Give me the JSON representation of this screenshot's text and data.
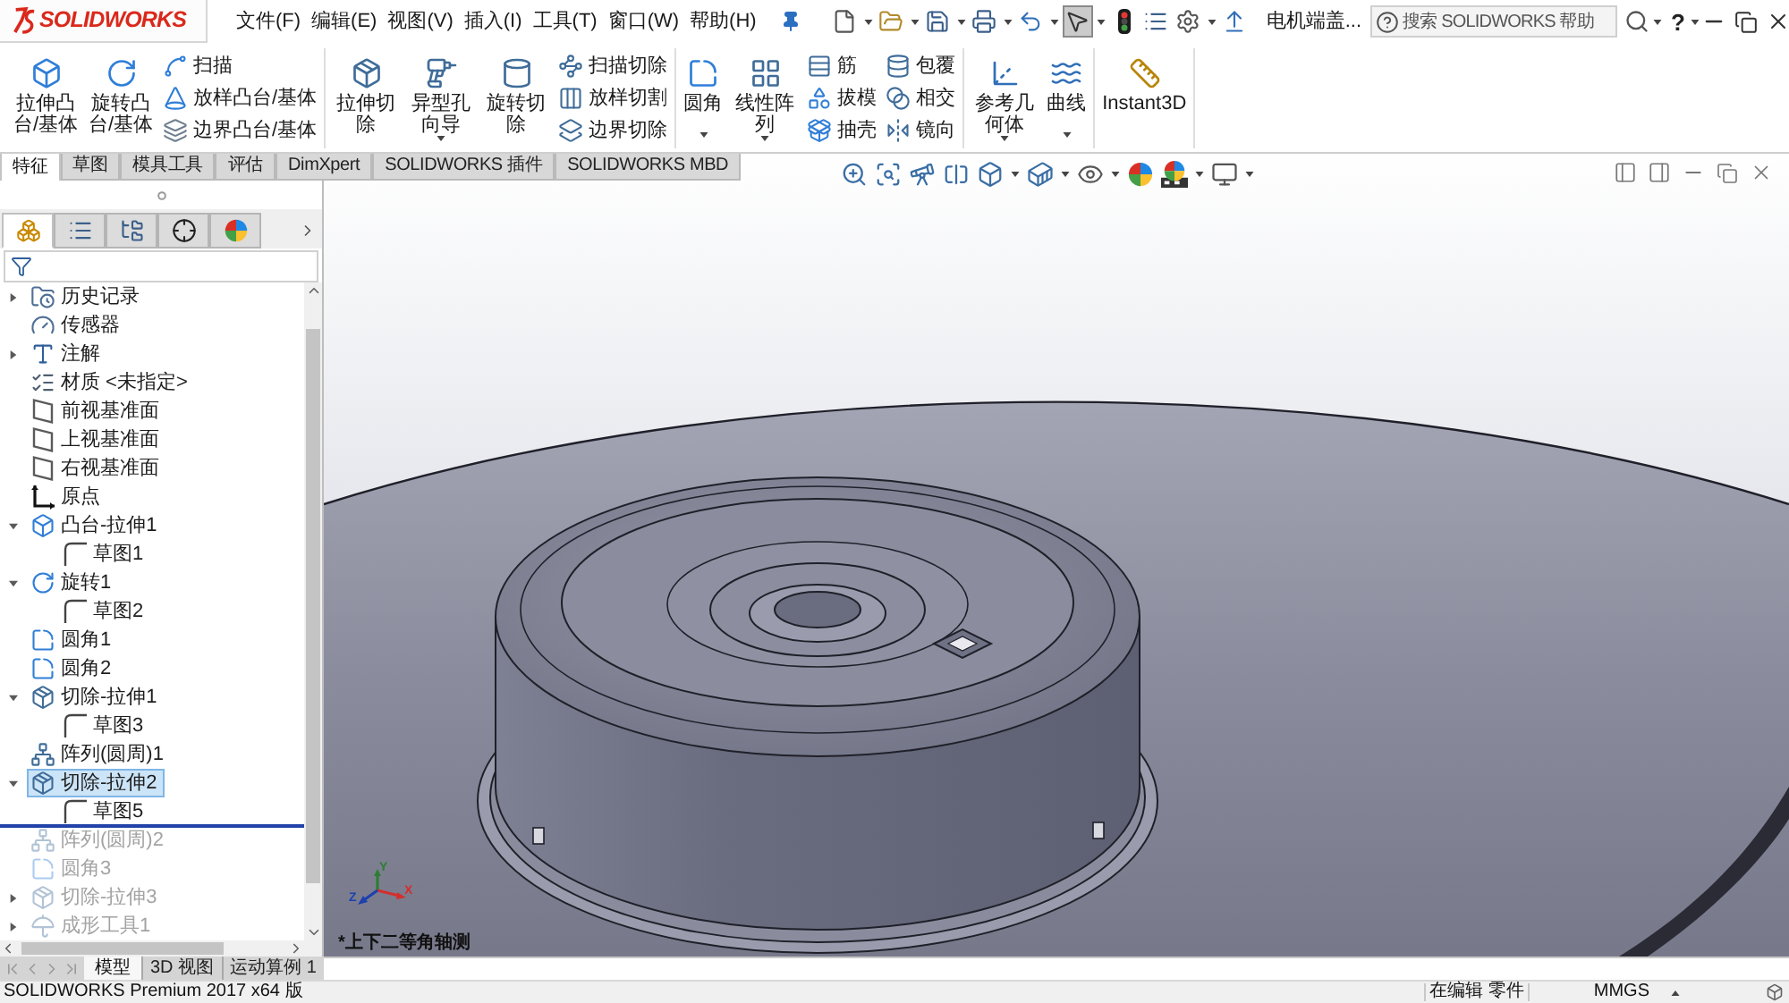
{
  "logo": {
    "text": "SOLIDWORKS"
  },
  "menu": [
    "文件(F)",
    "编辑(E)",
    "视图(V)",
    "插入(I)",
    "工具(T)",
    "窗口(W)",
    "帮助(H)"
  ],
  "quick_access": [
    {
      "kind": "new",
      "dropdown": true,
      "pressed": false
    },
    {
      "kind": "open",
      "dropdown": true,
      "pressed": false
    },
    {
      "kind": "save",
      "dropdown": true,
      "pressed": false
    },
    {
      "kind": "print",
      "dropdown": true,
      "pressed": false
    },
    {
      "kind": "undo",
      "dropdown": true,
      "pressed": false
    },
    {
      "kind": "select",
      "dropdown": true,
      "pressed": true
    },
    {
      "kind": "rebuild",
      "dropdown": false,
      "pressed": false
    },
    {
      "kind": "file_properties",
      "dropdown": false,
      "pressed": false
    },
    {
      "kind": "options",
      "dropdown": true,
      "pressed": false
    },
    {
      "kind": "reference",
      "dropdown": false,
      "pressed": false
    }
  ],
  "document_title": "电机端盖...",
  "search": {
    "placeholder": "搜索 SOLIDWORKS 帮助"
  },
  "help": {
    "label": "?"
  },
  "ribbon": [
    {
      "items": [
        {
          "kind": "large",
          "label": "拉伸凸台/基体",
          "dropdown": false
        },
        {
          "kind": "large",
          "label": "旋转凸台/基体",
          "dropdown": false
        },
        {
          "kind": "stack",
          "buttons": [
            "扫描",
            "放样凸台/基体",
            "边界凸台/基体"
          ]
        }
      ]
    },
    {
      "items": [
        {
          "kind": "large",
          "label": "拉伸切除",
          "dropdown": false
        },
        {
          "kind": "large",
          "label": "异型孔向导",
          "dropdown": true
        },
        {
          "kind": "large",
          "label": "旋转切除",
          "dropdown": false
        },
        {
          "kind": "stack",
          "buttons": [
            "扫描切除",
            "放样切割",
            "边界切除"
          ]
        }
      ]
    },
    {
      "items": [
        {
          "kind": "large",
          "label": "圆角",
          "dropdown": true
        },
        {
          "kind": "large",
          "label": "线性阵列",
          "dropdown": true
        },
        {
          "kind": "stack",
          "buttons": [
            "筋",
            "拔模",
            "抽壳"
          ]
        },
        {
          "kind": "stack",
          "buttons": [
            "包覆",
            "相交",
            "镜向"
          ]
        }
      ]
    },
    {
      "items": [
        {
          "kind": "large",
          "label": "参考几何体",
          "dropdown": true
        },
        {
          "kind": "large",
          "label": "曲线",
          "dropdown": true
        }
      ]
    },
    {
      "items": [
        {
          "kind": "large",
          "label": "Instant3D",
          "dropdown": false
        }
      ]
    }
  ],
  "tabs": [
    {
      "label": "特征",
      "selected": true
    },
    {
      "label": "草图",
      "selected": false
    },
    {
      "label": "模具工具",
      "selected": false
    },
    {
      "label": "评估",
      "selected": false
    },
    {
      "label": "DimXpert",
      "selected": false
    },
    {
      "label": "SOLIDWORKS 插件",
      "selected": false
    },
    {
      "label": "SOLIDWORKS MBD",
      "selected": false
    }
  ],
  "panel_tabs": [
    {
      "kind": "features",
      "selected": true
    },
    {
      "kind": "properties",
      "selected": false
    },
    {
      "kind": "configurations",
      "selected": false
    },
    {
      "kind": "dimxpert",
      "selected": false
    },
    {
      "kind": "display",
      "selected": false
    }
  ],
  "feature_tree": [
    {
      "kind": "history",
      "label": "历史记录",
      "expanded": false,
      "selected": false,
      "rolled_back": false
    },
    {
      "kind": "sensors",
      "label": "传感器",
      "selected": false,
      "rolled_back": false
    },
    {
      "kind": "annotations",
      "label": "注解",
      "expanded": false,
      "selected": false,
      "rolled_back": false
    },
    {
      "kind": "material",
      "label": "材质 <未指定>",
      "selected": false,
      "rolled_back": false
    },
    {
      "kind": "plane",
      "label": "前视基准面",
      "selected": false,
      "rolled_back": false
    },
    {
      "kind": "plane",
      "label": "上视基准面",
      "selected": false,
      "rolled_back": false
    },
    {
      "kind": "plane",
      "label": "右视基准面",
      "selected": false,
      "rolled_back": false
    },
    {
      "kind": "origin",
      "label": "原点",
      "selected": false,
      "rolled_back": false
    },
    {
      "kind": "extrude",
      "label": "凸台-拉伸1",
      "expanded": true,
      "selected": false,
      "rolled_back": false,
      "children": [
        {
          "kind": "sketch",
          "label": "草图1",
          "selected": false,
          "rolled_back": false
        }
      ]
    },
    {
      "kind": "revolve",
      "label": "旋转1",
      "expanded": true,
      "selected": false,
      "rolled_back": false,
      "children": [
        {
          "kind": "sketch",
          "label": "草图2",
          "selected": false,
          "rolled_back": false
        }
      ]
    },
    {
      "kind": "fillet",
      "label": "圆角1",
      "selected": false,
      "rolled_back": false
    },
    {
      "kind": "fillet",
      "label": "圆角2",
      "selected": false,
      "rolled_back": false
    },
    {
      "kind": "cut",
      "label": "切除-拉伸1",
      "expanded": true,
      "selected": false,
      "rolled_back": false,
      "children": [
        {
          "kind": "sketch",
          "label": "草图3",
          "selected": false,
          "rolled_back": false
        }
      ]
    },
    {
      "kind": "pattern",
      "label": "阵列(圆周)1",
      "selected": false,
      "rolled_back": false
    },
    {
      "kind": "cut",
      "label": "切除-拉伸2",
      "expanded": true,
      "selected": true,
      "rolled_back": false,
      "children": [
        {
          "kind": "sketch",
          "label": "草图5",
          "selected": false,
          "rolled_back": false
        }
      ]
    },
    {
      "kind": "pattern",
      "label": "阵列(圆周)2",
      "selected": false,
      "rolled_back": true
    },
    {
      "kind": "fillet",
      "label": "圆角3",
      "selected": false,
      "rolled_back": true
    },
    {
      "kind": "cut",
      "label": "切除-拉伸3",
      "expanded": false,
      "selected": false,
      "rolled_back": true
    },
    {
      "kind": "form_tool",
      "label": "成形工具1",
      "expanded": false,
      "selected": false,
      "rolled_back": true
    }
  ],
  "heads_up_toolbar": [
    {
      "kind": "zoom_fit",
      "dropdown": false
    },
    {
      "kind": "zoom_area",
      "dropdown": false
    },
    {
      "kind": "previous_view",
      "dropdown": false
    },
    {
      "kind": "section",
      "dropdown": false
    },
    {
      "kind": "orientation",
      "dropdown": true
    },
    {
      "kind": "display_style",
      "dropdown": true
    },
    {
      "kind": "hide_show",
      "dropdown": true
    },
    {
      "kind": "appearance",
      "dropdown": false
    },
    {
      "kind": "scene",
      "dropdown": true
    },
    {
      "kind": "view_settings",
      "dropdown": true
    }
  ],
  "viewport": {
    "view_name": "*上下二等角轴测",
    "triad_labels": [
      "X",
      "Y",
      "Z"
    ]
  },
  "model_tabs": [
    {
      "label": "模型",
      "selected": true
    },
    {
      "label": "3D 视图",
      "selected": false
    },
    {
      "label": "运动算例 1",
      "selected": false
    }
  ],
  "status_bar": {
    "product": "SOLIDWORKS Premium 2017 x64 版",
    "mode": "在编辑 零件",
    "units": "MMGS"
  }
}
